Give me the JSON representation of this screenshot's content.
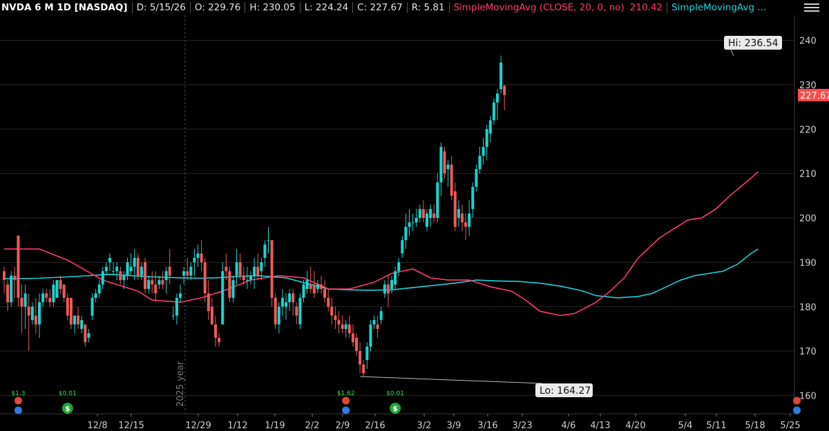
{
  "header": {
    "symbol": "NVDA 6 M 1D [NASDAQ]",
    "date": "D: 5/15/26",
    "open": "O: 229.76",
    "high": "H: 230.05",
    "low": "L: 224.24",
    "close": "C: 227.67",
    "range": "R: 5.81",
    "sma20_label": "SimpleMovingAvg (CLOSE, 20, 0, no)",
    "sma20_value": "210.42",
    "sma50_label": "SimpleMovingAvg ..."
  },
  "icons": {
    "menu": "hamburger-menu-icon"
  },
  "colors": {
    "up": "#16d6d0",
    "down": "#ef5a5a",
    "sma20": "#ff3d6e",
    "sma50": "#1fd4dc",
    "grid": "#262626",
    "price_tag": "#ff4d4d"
  },
  "chart_data": {
    "type": "candlestick",
    "ylim": [
      155,
      245
    ],
    "y_ticks": [
      160,
      170,
      180,
      190,
      200,
      210,
      220,
      230,
      240
    ],
    "x_tick_labels": [
      "12/8",
      "12/15",
      "12/29",
      "1/12",
      "1/19",
      "2/2",
      "2/9",
      "2/16",
      "3/2",
      "3/9",
      "3/16",
      "3/23",
      "4/6",
      "4/13",
      "4/20",
      "5/4",
      "5/11",
      "5/18",
      "5/25"
    ],
    "year_marker": "2025 year",
    "last_price": "227.67",
    "high_callout": "Hi: 236.54",
    "low_callout": "Lo: 164.27",
    "candles": [
      {
        "o": 188,
        "h": 189,
        "l": 183,
        "c": 186
      },
      {
        "o": 185,
        "h": 186,
        "l": 179,
        "c": 181
      },
      {
        "o": 181,
        "h": 188,
        "l": 180,
        "c": 187
      },
      {
        "o": 187,
        "h": 189,
        "l": 182,
        "c": 186
      },
      {
        "o": 196,
        "h": 196,
        "l": 180,
        "c": 182
      },
      {
        "o": 182,
        "h": 185,
        "l": 174,
        "c": 180
      },
      {
        "o": 180,
        "h": 185,
        "l": 175,
        "c": 183
      },
      {
        "o": 180,
        "h": 183,
        "l": 170,
        "c": 178
      },
      {
        "o": 177,
        "h": 181,
        "l": 176,
        "c": 180
      },
      {
        "o": 178,
        "h": 182,
        "l": 174,
        "c": 176
      },
      {
        "o": 176,
        "h": 183,
        "l": 173,
        "c": 181
      },
      {
        "o": 181,
        "h": 184,
        "l": 180,
        "c": 183
      },
      {
        "o": 183,
        "h": 184,
        "l": 181,
        "c": 182
      },
      {
        "o": 182,
        "h": 184,
        "l": 180,
        "c": 181
      },
      {
        "o": 181,
        "h": 186,
        "l": 180,
        "c": 185
      },
      {
        "o": 182,
        "h": 186,
        "l": 182,
        "c": 186
      },
      {
        "o": 186,
        "h": 187,
        "l": 183,
        "c": 184
      },
      {
        "o": 185,
        "h": 185,
        "l": 181,
        "c": 182
      },
      {
        "o": 182,
        "h": 183,
        "l": 177,
        "c": 178
      },
      {
        "o": 182,
        "h": 182,
        "l": 175,
        "c": 176
      },
      {
        "o": 176,
        "h": 178,
        "l": 174,
        "c": 178
      },
      {
        "o": 178,
        "h": 180,
        "l": 175,
        "c": 176
      },
      {
        "o": 175,
        "h": 178,
        "l": 174,
        "c": 177
      },
      {
        "o": 176,
        "h": 176,
        "l": 171,
        "c": 172
      },
      {
        "o": 173,
        "h": 175,
        "l": 172,
        "c": 174
      },
      {
        "o": 178,
        "h": 183,
        "l": 177,
        "c": 182
      },
      {
        "o": 182,
        "h": 184,
        "l": 181,
        "c": 183
      },
      {
        "o": 183,
        "h": 186,
        "l": 182,
        "c": 185
      },
      {
        "o": 185,
        "h": 189,
        "l": 184,
        "c": 188
      },
      {
        "o": 188,
        "h": 190,
        "l": 187,
        "c": 189
      },
      {
        "o": 190,
        "h": 192,
        "l": 188,
        "c": 191
      },
      {
        "o": 188,
        "h": 190,
        "l": 187,
        "c": 188
      },
      {
        "o": 188,
        "h": 190,
        "l": 186,
        "c": 189
      },
      {
        "o": 188,
        "h": 189,
        "l": 185,
        "c": 186
      },
      {
        "o": 186,
        "h": 188,
        "l": 184,
        "c": 187
      },
      {
        "o": 187,
        "h": 191,
        "l": 186,
        "c": 190
      },
      {
        "o": 188,
        "h": 192,
        "l": 187,
        "c": 189
      },
      {
        "o": 189,
        "h": 193,
        "l": 186,
        "c": 191
      },
      {
        "o": 191,
        "h": 192,
        "l": 186,
        "c": 187
      },
      {
        "o": 187,
        "h": 190,
        "l": 186,
        "c": 189
      },
      {
        "o": 190,
        "h": 191,
        "l": 183,
        "c": 184
      },
      {
        "o": 184,
        "h": 187,
        "l": 183,
        "c": 186
      },
      {
        "o": 186,
        "h": 188,
        "l": 183,
        "c": 185
      },
      {
        "o": 185,
        "h": 188,
        "l": 181,
        "c": 183
      },
      {
        "o": 185,
        "h": 187,
        "l": 184,
        "c": 186
      },
      {
        "o": 186,
        "h": 188,
        "l": 184,
        "c": 185
      },
      {
        "o": 186,
        "h": 189,
        "l": 183,
        "c": 188
      },
      {
        "o": 189,
        "h": 193,
        "l": 185,
        "c": 187
      },
      {
        "o": 178,
        "h": 180,
        "l": 177,
        "c": 178
      },
      {
        "o": 178,
        "h": 183,
        "l": 176,
        "c": 182
      },
      {
        "o": 182,
        "h": 185,
        "l": 181,
        "c": 183
      },
      {
        "o": 187,
        "h": 189,
        "l": 185,
        "c": 188
      },
      {
        "o": 188,
        "h": 191,
        "l": 186,
        "c": 187
      },
      {
        "o": 187,
        "h": 190,
        "l": 186,
        "c": 189
      },
      {
        "o": 190,
        "h": 193,
        "l": 187,
        "c": 191
      },
      {
        "o": 191,
        "h": 194,
        "l": 189,
        "c": 192
      },
      {
        "o": 192,
        "h": 195,
        "l": 188,
        "c": 190
      },
      {
        "o": 190,
        "h": 191,
        "l": 181,
        "c": 183
      },
      {
        "o": 183,
        "h": 186,
        "l": 177,
        "c": 179
      },
      {
        "o": 180,
        "h": 182,
        "l": 177,
        "c": 176
      },
      {
        "o": 176,
        "h": 178,
        "l": 171,
        "c": 173
      },
      {
        "o": 173,
        "h": 174,
        "l": 171,
        "c": 172
      },
      {
        "o": 176,
        "h": 190,
        "l": 176,
        "c": 188
      },
      {
        "o": 189,
        "h": 192,
        "l": 186,
        "c": 188
      },
      {
        "o": 188,
        "h": 189,
        "l": 181,
        "c": 182
      },
      {
        "o": 182,
        "h": 187,
        "l": 181,
        "c": 186
      },
      {
        "o": 187,
        "h": 193,
        "l": 185,
        "c": 190
      },
      {
        "o": 190,
        "h": 192,
        "l": 186,
        "c": 187
      },
      {
        "o": 187,
        "h": 189,
        "l": 185,
        "c": 186
      },
      {
        "o": 186,
        "h": 189,
        "l": 184,
        "c": 186
      },
      {
        "o": 186,
        "h": 188,
        "l": 185,
        "c": 187
      },
      {
        "o": 187,
        "h": 191,
        "l": 184,
        "c": 189
      },
      {
        "o": 189,
        "h": 192,
        "l": 186,
        "c": 187
      },
      {
        "o": 188,
        "h": 191,
        "l": 186,
        "c": 190
      },
      {
        "o": 191,
        "h": 195,
        "l": 189,
        "c": 194
      },
      {
        "o": 195,
        "h": 198,
        "l": 192,
        "c": 195
      },
      {
        "o": 195,
        "h": 195,
        "l": 180,
        "c": 182
      },
      {
        "o": 182,
        "h": 183,
        "l": 175,
        "c": 176
      },
      {
        "o": 176,
        "h": 181,
        "l": 174,
        "c": 180
      },
      {
        "o": 180,
        "h": 184,
        "l": 178,
        "c": 182
      },
      {
        "o": 180,
        "h": 183,
        "l": 177,
        "c": 181
      },
      {
        "o": 181,
        "h": 184,
        "l": 179,
        "c": 183
      },
      {
        "o": 183,
        "h": 184,
        "l": 178,
        "c": 181
      },
      {
        "o": 180,
        "h": 181,
        "l": 176,
        "c": 178
      },
      {
        "o": 176,
        "h": 183,
        "l": 175,
        "c": 182
      },
      {
        "o": 182,
        "h": 186,
        "l": 181,
        "c": 185
      },
      {
        "o": 184,
        "h": 188,
        "l": 183,
        "c": 186
      },
      {
        "o": 185,
        "h": 189,
        "l": 183,
        "c": 184
      },
      {
        "o": 185,
        "h": 188,
        "l": 182,
        "c": 183
      },
      {
        "o": 184,
        "h": 186,
        "l": 183,
        "c": 185
      },
      {
        "o": 185,
        "h": 187,
        "l": 183,
        "c": 184
      },
      {
        "o": 184,
        "h": 186,
        "l": 181,
        "c": 182
      },
      {
        "o": 182,
        "h": 184,
        "l": 179,
        "c": 180
      },
      {
        "o": 180,
        "h": 182,
        "l": 176,
        "c": 178
      },
      {
        "o": 178,
        "h": 180,
        "l": 175,
        "c": 177
      },
      {
        "o": 177,
        "h": 179,
        "l": 174,
        "c": 176
      },
      {
        "o": 176,
        "h": 178,
        "l": 174,
        "c": 175
      },
      {
        "o": 175,
        "h": 177,
        "l": 173,
        "c": 176
      },
      {
        "o": 176,
        "h": 178,
        "l": 173,
        "c": 174
      },
      {
        "o": 174,
        "h": 176,
        "l": 171,
        "c": 172
      },
      {
        "o": 173,
        "h": 174,
        "l": 169,
        "c": 170
      },
      {
        "o": 170,
        "h": 172,
        "l": 165,
        "c": 167
      },
      {
        "o": 167,
        "h": 168,
        "l": 164.27,
        "c": 165
      },
      {
        "o": 168,
        "h": 172,
        "l": 166,
        "c": 171
      },
      {
        "o": 171,
        "h": 177,
        "l": 170,
        "c": 176
      },
      {
        "o": 176,
        "h": 178,
        "l": 175,
        "c": 177
      },
      {
        "o": 176,
        "h": 178,
        "l": 173,
        "c": 175
      },
      {
        "o": 177,
        "h": 180,
        "l": 176,
        "c": 179
      },
      {
        "o": 183,
        "h": 186,
        "l": 182,
        "c": 185
      },
      {
        "o": 185,
        "h": 187,
        "l": 180,
        "c": 183
      },
      {
        "o": 184,
        "h": 187,
        "l": 183,
        "c": 186
      },
      {
        "o": 185,
        "h": 189,
        "l": 184,
        "c": 188
      },
      {
        "o": 188,
        "h": 191,
        "l": 187,
        "c": 190
      },
      {
        "o": 192,
        "h": 196,
        "l": 191,
        "c": 195
      },
      {
        "o": 195,
        "h": 201,
        "l": 193,
        "c": 198
      },
      {
        "o": 198,
        "h": 202,
        "l": 196,
        "c": 199
      },
      {
        "o": 199,
        "h": 201,
        "l": 197,
        "c": 199
      },
      {
        "o": 199,
        "h": 202,
        "l": 198,
        "c": 200
      },
      {
        "o": 200,
        "h": 203,
        "l": 199,
        "c": 202
      },
      {
        "o": 202,
        "h": 204,
        "l": 199,
        "c": 200
      },
      {
        "o": 198,
        "h": 202,
        "l": 197,
        "c": 201
      },
      {
        "o": 200,
        "h": 203,
        "l": 198,
        "c": 202
      },
      {
        "o": 201,
        "h": 203,
        "l": 199,
        "c": 200
      },
      {
        "o": 200,
        "h": 210,
        "l": 199,
        "c": 208
      },
      {
        "o": 208,
        "h": 217,
        "l": 205,
        "c": 216
      },
      {
        "o": 215,
        "h": 216,
        "l": 209,
        "c": 210
      },
      {
        "o": 211,
        "h": 213,
        "l": 207,
        "c": 212
      },
      {
        "o": 212,
        "h": 214,
        "l": 204,
        "c": 205
      },
      {
        "o": 206,
        "h": 208,
        "l": 197,
        "c": 198
      },
      {
        "o": 200,
        "h": 204,
        "l": 198,
        "c": 202
      },
      {
        "o": 201,
        "h": 203,
        "l": 197,
        "c": 199
      },
      {
        "o": 199,
        "h": 201,
        "l": 195,
        "c": 198
      },
      {
        "o": 198,
        "h": 204,
        "l": 196,
        "c": 201
      },
      {
        "o": 202,
        "h": 208,
        "l": 200,
        "c": 207
      },
      {
        "o": 207,
        "h": 212,
        "l": 206,
        "c": 211
      },
      {
        "o": 211,
        "h": 216,
        "l": 210,
        "c": 214
      },
      {
        "o": 214,
        "h": 218,
        "l": 212,
        "c": 216
      },
      {
        "o": 216,
        "h": 221,
        "l": 213,
        "c": 220
      },
      {
        "o": 219,
        "h": 223,
        "l": 217,
        "c": 222
      },
      {
        "o": 222,
        "h": 227,
        "l": 221,
        "c": 226
      },
      {
        "o": 226,
        "h": 229,
        "l": 222,
        "c": 228
      },
      {
        "o": 229,
        "h": 236.54,
        "l": 228,
        "c": 235
      },
      {
        "o": 229.76,
        "h": 230.05,
        "l": 224.24,
        "c": 227.67
      }
    ],
    "sma20": [
      [
        0,
        193
      ],
      [
        10,
        193
      ],
      [
        18,
        190.5
      ],
      [
        28,
        186
      ],
      [
        38,
        183.5
      ],
      [
        42,
        181.5
      ],
      [
        50,
        181
      ],
      [
        56,
        182
      ],
      [
        62,
        183.5
      ],
      [
        70,
        186
      ],
      [
        78,
        187
      ],
      [
        85,
        186.5
      ],
      [
        92,
        184
      ],
      [
        98,
        184
      ],
      [
        105,
        185.5
      ],
      [
        110,
        187.5
      ],
      [
        116,
        188.5
      ],
      [
        121,
        186.5
      ],
      [
        126,
        186
      ],
      [
        132,
        186
      ],
      [
        138,
        184.5
      ],
      [
        144,
        183.5
      ],
      [
        148,
        181.5
      ],
      [
        152,
        179
      ],
      [
        158,
        178
      ],
      [
        162,
        178.5
      ],
      [
        168,
        181
      ],
      [
        172,
        183.5
      ],
      [
        176,
        186.5
      ],
      [
        180,
        191
      ],
      [
        186,
        195.5
      ],
      [
        190,
        197.5
      ],
      [
        194,
        199.5
      ],
      [
        198,
        200
      ],
      [
        202,
        202
      ],
      [
        206,
        205
      ],
      [
        212,
        209
      ],
      [
        214,
        210.42
      ]
    ],
    "sma50": [
      [
        0,
        186.3
      ],
      [
        10,
        186.4
      ],
      [
        20,
        186.8
      ],
      [
        30,
        187.3
      ],
      [
        40,
        186.8
      ],
      [
        50,
        186.5
      ],
      [
        56,
        186.4
      ],
      [
        60,
        186.5
      ],
      [
        66,
        186.8
      ],
      [
        72,
        187
      ],
      [
        80,
        186.5
      ],
      [
        86,
        185.2
      ],
      [
        92,
        184
      ],
      [
        98,
        183.8
      ],
      [
        104,
        183.7
      ],
      [
        110,
        183.8
      ],
      [
        116,
        184.3
      ],
      [
        122,
        184.8
      ],
      [
        128,
        185.3
      ],
      [
        134,
        186
      ],
      [
        140,
        185.8
      ],
      [
        146,
        185.7
      ],
      [
        152,
        185.3
      ],
      [
        158,
        184.6
      ],
      [
        164,
        183.6
      ],
      [
        168,
        182.5
      ],
      [
        174,
        182
      ],
      [
        180,
        182.3
      ],
      [
        184,
        183
      ],
      [
        188,
        184.5
      ],
      [
        192,
        186
      ],
      [
        196,
        187
      ],
      [
        200,
        187.5
      ],
      [
        204,
        188
      ],
      [
        208,
        189.5
      ],
      [
        212,
        192
      ],
      [
        214,
        193
      ]
    ],
    "event_markers": [
      {
        "label": "$1.3",
        "kind": "earnings",
        "x": 4
      },
      {
        "label": "$0.01",
        "kind": "dividend",
        "x": 18
      },
      {
        "label": "$1.62",
        "kind": "earnings",
        "x": 97
      },
      {
        "label": "$0.01",
        "kind": "dividend",
        "x": 111
      },
      {
        "label": "",
        "kind": "earnings",
        "x": 225
      }
    ]
  }
}
